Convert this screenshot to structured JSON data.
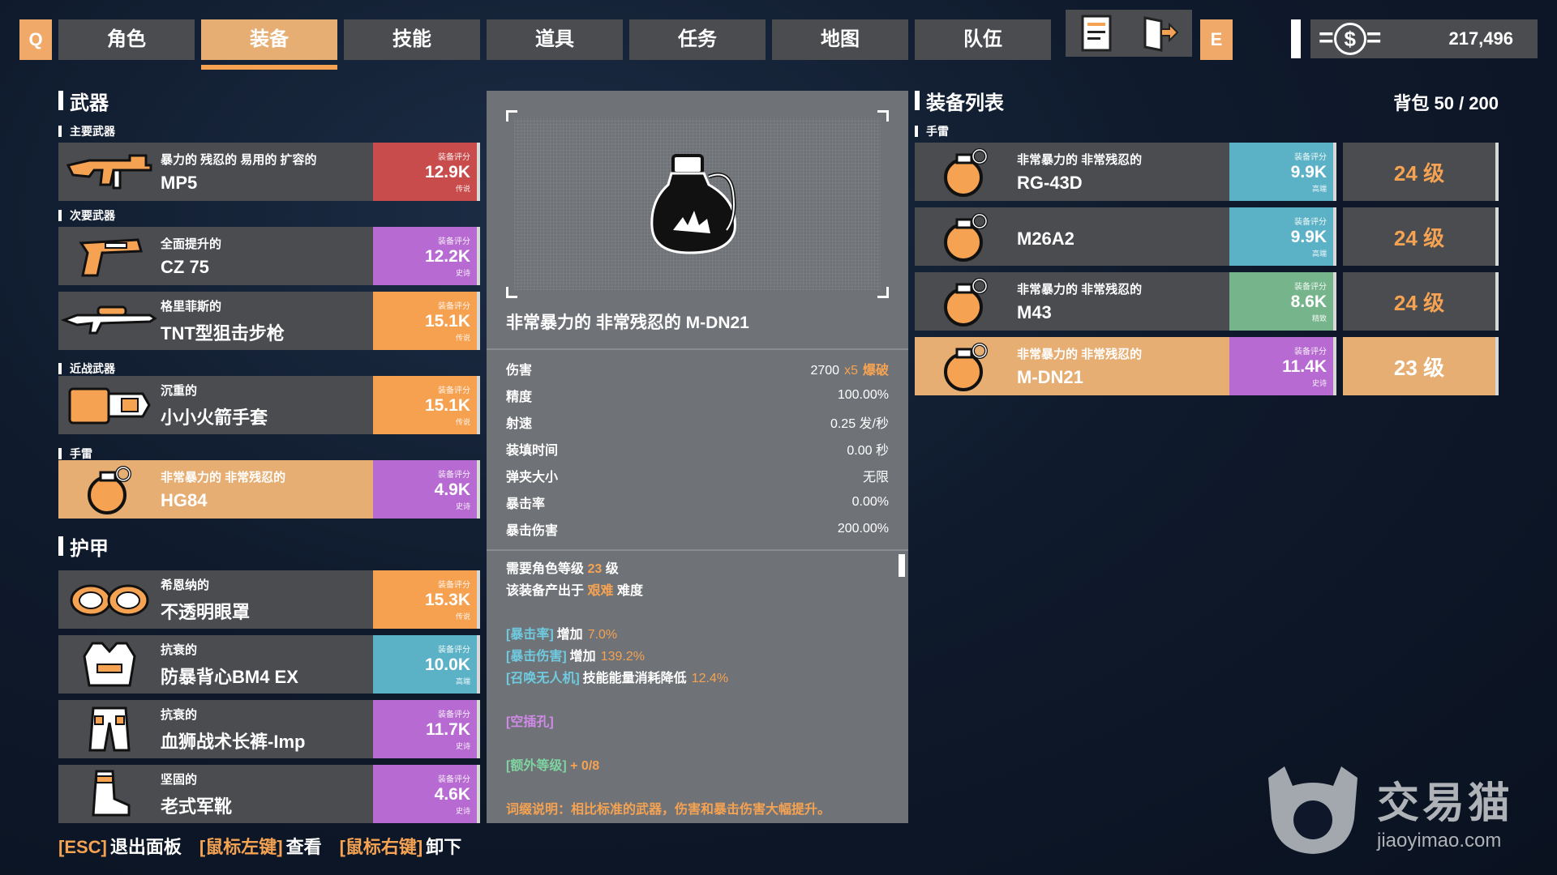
{
  "nav": {
    "key_left": "Q",
    "key_right": "E",
    "tabs": [
      "角色",
      "装备",
      "技能",
      "道具",
      "任务",
      "地图",
      "队伍"
    ],
    "active_tab": 1
  },
  "currency": {
    "amount": "217,496",
    "icon": "dollar-icon"
  },
  "weapons": {
    "title": "武器",
    "groups": [
      {
        "label": "主要武器",
        "items": [
          {
            "prefix": "暴力的 残忍的 易用的 扩容的",
            "name": "MP5",
            "score_label": "装备评分",
            "score": "12.9K",
            "rarity": "传说",
            "color": "#c94c4c",
            "icon": "smg-icon"
          }
        ]
      },
      {
        "label": "次要武器",
        "items": [
          {
            "prefix": "全面提升的",
            "name": "CZ 75",
            "score_label": "装备评分",
            "score": "12.2K",
            "rarity": "史诗",
            "color": "#b76ad2",
            "icon": "pistol-icon"
          },
          {
            "prefix": "格里菲斯的",
            "name": "TNT型狙击步枪",
            "score_label": "装备评分",
            "score": "15.1K",
            "rarity": "传说",
            "color": "#f6a14f",
            "icon": "sniper-rifle-icon"
          }
        ]
      },
      {
        "label": "近战武器",
        "items": [
          {
            "prefix": "沉重的",
            "name": "小小火箭手套",
            "score_label": "装备评分",
            "score": "15.1K",
            "rarity": "传说",
            "color": "#f6a14f",
            "icon": "rocket-glove-icon"
          }
        ]
      },
      {
        "label": "手雷",
        "items": [
          {
            "prefix": "非常暴力的 非常残忍的",
            "name": "HG84",
            "score_label": "装备评分",
            "score": "4.9K",
            "rarity": "史诗",
            "color": "#b76ad2",
            "icon": "grenade-icon",
            "selected": true
          }
        ]
      }
    ]
  },
  "armor": {
    "title": "护甲",
    "items": [
      {
        "prefix": "希恩纳的",
        "name": "不透明眼罩",
        "score_label": "装备评分",
        "score": "15.3K",
        "rarity": "传说",
        "color": "#f6a14f",
        "icon": "goggles-icon"
      },
      {
        "prefix": "抗衰的",
        "name": "防暴背心BM4 EX",
        "score_label": "装备评分",
        "score": "10.0K",
        "rarity": "高端",
        "color": "#5bb2c6",
        "icon": "vest-icon"
      },
      {
        "prefix": "抗衰的",
        "name": "血狮战术长裤-Imp",
        "score_label": "装备评分",
        "score": "11.7K",
        "rarity": "史诗",
        "color": "#b76ad2",
        "icon": "pants-icon"
      },
      {
        "prefix": "坚固的",
        "name": "老式军靴",
        "score_label": "装备评分",
        "score": "4.6K",
        "rarity": "史诗",
        "color": "#b76ad2",
        "icon": "boots-icon"
      }
    ]
  },
  "hints": [
    {
      "key": "[ESC]",
      "action": "退出面板"
    },
    {
      "key": "[鼠标左键]",
      "action": "查看"
    },
    {
      "key": "[鼠标右键]",
      "action": "卸下"
    }
  ],
  "detail": {
    "title": "非常暴力的 非常残忍的 M-DN21",
    "icon": "grenade-icon",
    "stats": [
      {
        "label": "伤害",
        "value": "2700",
        "mult": "x5",
        "extra": "爆破"
      },
      {
        "label": "精度",
        "value": "100.00%"
      },
      {
        "label": "射速",
        "value": "0.25 发/秒"
      },
      {
        "label": "装填时间",
        "value": "0.00 秒"
      },
      {
        "label": "弹夹大小",
        "value": "无限"
      },
      {
        "label": "暴击率",
        "value": "0.00%"
      },
      {
        "label": "暴击伤害",
        "value": "200.00%"
      }
    ],
    "req_prefix": "需要角色等级",
    "req_level": "23",
    "req_suffix": "级",
    "drop_prefix": "该装备产出于",
    "drop_difficulty": "艰难",
    "drop_suffix": "难度",
    "affixes": [
      {
        "tag": "[暴击率]",
        "text": "增加",
        "val": "7.0%"
      },
      {
        "tag": "[暴击伤害]",
        "text": "增加",
        "val": "139.2%"
      },
      {
        "tag": "[召唤无人机]",
        "text": "技能能量消耗降低",
        "val": "12.4%"
      }
    ],
    "socket": "[空插孔]",
    "extra_level_tag": "[额外等级]",
    "extra_level_val": "+ 0/8",
    "note": "词缀说明：相比标准的武器，伤害和暴击伤害大幅提升。"
  },
  "equip_list": {
    "title": "装备列表",
    "bag_label": "背包",
    "bag_count": "50 / 200",
    "sub_label": "手雷",
    "items": [
      {
        "prefix": "非常暴力的 非常残忍的",
        "name": "RG-43D",
        "score_label": "装备评分",
        "score": "9.9K",
        "rarity": "高端",
        "color": "#5bb2c6",
        "level": "24 级"
      },
      {
        "prefix": "",
        "name": "M26A2",
        "score_label": "装备评分",
        "score": "9.9K",
        "rarity": "高端",
        "color": "#5bb2c6",
        "level": "24 级"
      },
      {
        "prefix": "非常暴力的 非常残忍的",
        "name": "M43",
        "score_label": "装备评分",
        "score": "8.6K",
        "rarity": "精致",
        "color": "#76b58c",
        "level": "24 级"
      },
      {
        "prefix": "非常暴力的 非常残忍的",
        "name": "M-DN21",
        "score_label": "装备评分",
        "score": "11.4K",
        "rarity": "史诗",
        "color": "#b76ad2",
        "level": "23 级",
        "selected": true
      }
    ]
  },
  "watermark": {
    "brand": "交易猫",
    "url": "jiaoyimao.com"
  }
}
